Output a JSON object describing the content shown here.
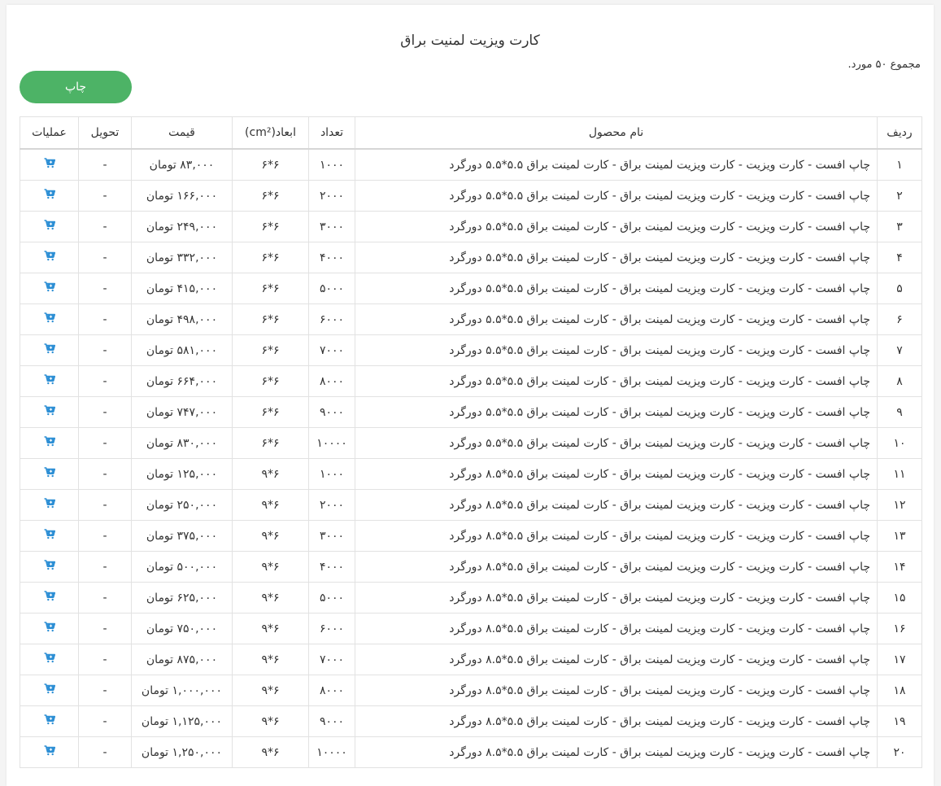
{
  "page": {
    "title": "کارت ویزیت لمنیت براق",
    "total_text": "مجموع ۵۰ مورد.",
    "print_label": "چاپ"
  },
  "table": {
    "headers": {
      "row": "ردیف",
      "name": "نام محصول",
      "count": "تعداد",
      "dims": "ابعاد(cm²)",
      "price": "قیمت",
      "delivery": "تحویل",
      "ops": "عملیات"
    },
    "rows": [
      {
        "row": "۱",
        "name": "چاپ افست - کارت ویزیت - کارت ویزیت لمینت براق - کارت لمینت براق ۵.۵*۵.۵ دورگرد",
        "count": "۱۰۰۰",
        "dims": "۶*۶",
        "price": "۸۳,۰۰۰ تومان",
        "delivery": "-"
      },
      {
        "row": "۲",
        "name": "چاپ افست - کارت ویزیت - کارت ویزیت لمینت براق - کارت لمینت براق ۵.۵*۵.۵ دورگرد",
        "count": "۲۰۰۰",
        "dims": "۶*۶",
        "price": "۱۶۶,۰۰۰ تومان",
        "delivery": "-"
      },
      {
        "row": "۳",
        "name": "چاپ افست - کارت ویزیت - کارت ویزیت لمینت براق - کارت لمینت براق ۵.۵*۵.۵ دورگرد",
        "count": "۳۰۰۰",
        "dims": "۶*۶",
        "price": "۲۴۹,۰۰۰ تومان",
        "delivery": "-"
      },
      {
        "row": "۴",
        "name": "چاپ افست - کارت ویزیت - کارت ویزیت لمینت براق - کارت لمینت براق ۵.۵*۵.۵ دورگرد",
        "count": "۴۰۰۰",
        "dims": "۶*۶",
        "price": "۳۳۲,۰۰۰ تومان",
        "delivery": "-"
      },
      {
        "row": "۵",
        "name": "چاپ افست - کارت ویزیت - کارت ویزیت لمینت براق - کارت لمینت براق ۵.۵*۵.۵ دورگرد",
        "count": "۵۰۰۰",
        "dims": "۶*۶",
        "price": "۴۱۵,۰۰۰ تومان",
        "delivery": "-"
      },
      {
        "row": "۶",
        "name": "چاپ افست - کارت ویزیت - کارت ویزیت لمینت براق - کارت لمینت براق ۵.۵*۵.۵ دورگرد",
        "count": "۶۰۰۰",
        "dims": "۶*۶",
        "price": "۴۹۸,۰۰۰ تومان",
        "delivery": "-"
      },
      {
        "row": "۷",
        "name": "چاپ افست - کارت ویزیت - کارت ویزیت لمینت براق - کارت لمینت براق ۵.۵*۵.۵ دورگرد",
        "count": "۷۰۰۰",
        "dims": "۶*۶",
        "price": "۵۸۱,۰۰۰ تومان",
        "delivery": "-"
      },
      {
        "row": "۸",
        "name": "چاپ افست - کارت ویزیت - کارت ویزیت لمینت براق - کارت لمینت براق ۵.۵*۵.۵ دورگرد",
        "count": "۸۰۰۰",
        "dims": "۶*۶",
        "price": "۶۶۴,۰۰۰ تومان",
        "delivery": "-"
      },
      {
        "row": "۹",
        "name": "چاپ افست - کارت ویزیت - کارت ویزیت لمینت براق - کارت لمینت براق ۵.۵*۵.۵ دورگرد",
        "count": "۹۰۰۰",
        "dims": "۶*۶",
        "price": "۷۴۷,۰۰۰ تومان",
        "delivery": "-"
      },
      {
        "row": "۱۰",
        "name": "چاپ افست - کارت ویزیت - کارت ویزیت لمینت براق - کارت لمینت براق ۵.۵*۵.۵ دورگرد",
        "count": "۱۰۰۰۰",
        "dims": "۶*۶",
        "price": "۸۳۰,۰۰۰ تومان",
        "delivery": "-"
      },
      {
        "row": "۱۱",
        "name": "چاپ افست - کارت ویزیت - کارت ویزیت لمینت براق - کارت لمینت براق ۵.۵*۸.۵ دورگرد",
        "count": "۱۰۰۰",
        "dims": "۶*۹",
        "price": "۱۲۵,۰۰۰ تومان",
        "delivery": "-"
      },
      {
        "row": "۱۲",
        "name": "چاپ افست - کارت ویزیت - کارت ویزیت لمینت براق - کارت لمینت براق ۵.۵*۸.۵ دورگرد",
        "count": "۲۰۰۰",
        "dims": "۶*۹",
        "price": "۲۵۰,۰۰۰ تومان",
        "delivery": "-"
      },
      {
        "row": "۱۳",
        "name": "چاپ افست - کارت ویزیت - کارت ویزیت لمینت براق - کارت لمینت براق ۵.۵*۸.۵ دورگرد",
        "count": "۳۰۰۰",
        "dims": "۶*۹",
        "price": "۳۷۵,۰۰۰ تومان",
        "delivery": "-"
      },
      {
        "row": "۱۴",
        "name": "چاپ افست - کارت ویزیت - کارت ویزیت لمینت براق - کارت لمینت براق ۵.۵*۸.۵ دورگرد",
        "count": "۴۰۰۰",
        "dims": "۶*۹",
        "price": "۵۰۰,۰۰۰ تومان",
        "delivery": "-"
      },
      {
        "row": "۱۵",
        "name": "چاپ افست - کارت ویزیت - کارت ویزیت لمینت براق - کارت لمینت براق ۵.۵*۸.۵ دورگرد",
        "count": "۵۰۰۰",
        "dims": "۶*۹",
        "price": "۶۲۵,۰۰۰ تومان",
        "delivery": "-"
      },
      {
        "row": "۱۶",
        "name": "چاپ افست - کارت ویزیت - کارت ویزیت لمینت براق - کارت لمینت براق ۵.۵*۸.۵ دورگرد",
        "count": "۶۰۰۰",
        "dims": "۶*۹",
        "price": "۷۵۰,۰۰۰ تومان",
        "delivery": "-"
      },
      {
        "row": "۱۷",
        "name": "چاپ افست - کارت ویزیت - کارت ویزیت لمینت براق - کارت لمینت براق ۵.۵*۸.۵ دورگرد",
        "count": "۷۰۰۰",
        "dims": "۶*۹",
        "price": "۸۷۵,۰۰۰ تومان",
        "delivery": "-"
      },
      {
        "row": "۱۸",
        "name": "چاپ افست - کارت ویزیت - کارت ویزیت لمینت براق - کارت لمینت براق ۵.۵*۸.۵ دورگرد",
        "count": "۸۰۰۰",
        "dims": "۶*۹",
        "price": "۱,۰۰۰,۰۰۰ تومان",
        "delivery": "-"
      },
      {
        "row": "۱۹",
        "name": "چاپ افست - کارت ویزیت - کارت ویزیت لمینت براق - کارت لمینت براق ۵.۵*۸.۵ دورگرد",
        "count": "۹۰۰۰",
        "dims": "۶*۹",
        "price": "۱,۱۲۵,۰۰۰ تومان",
        "delivery": "-"
      },
      {
        "row": "۲۰",
        "name": "چاپ افست - کارت ویزیت - کارت ویزیت لمینت براق - کارت لمینت براق ۵.۵*۸.۵ دورگرد",
        "count": "۱۰۰۰۰",
        "dims": "۶*۹",
        "price": "۱,۲۵۰,۰۰۰ تومان",
        "delivery": "-"
      }
    ],
    "row_action_icon": "add-to-cart-icon"
  },
  "colors": {
    "print_button": "#4db366",
    "cart_icon": "#2d8fd5"
  }
}
